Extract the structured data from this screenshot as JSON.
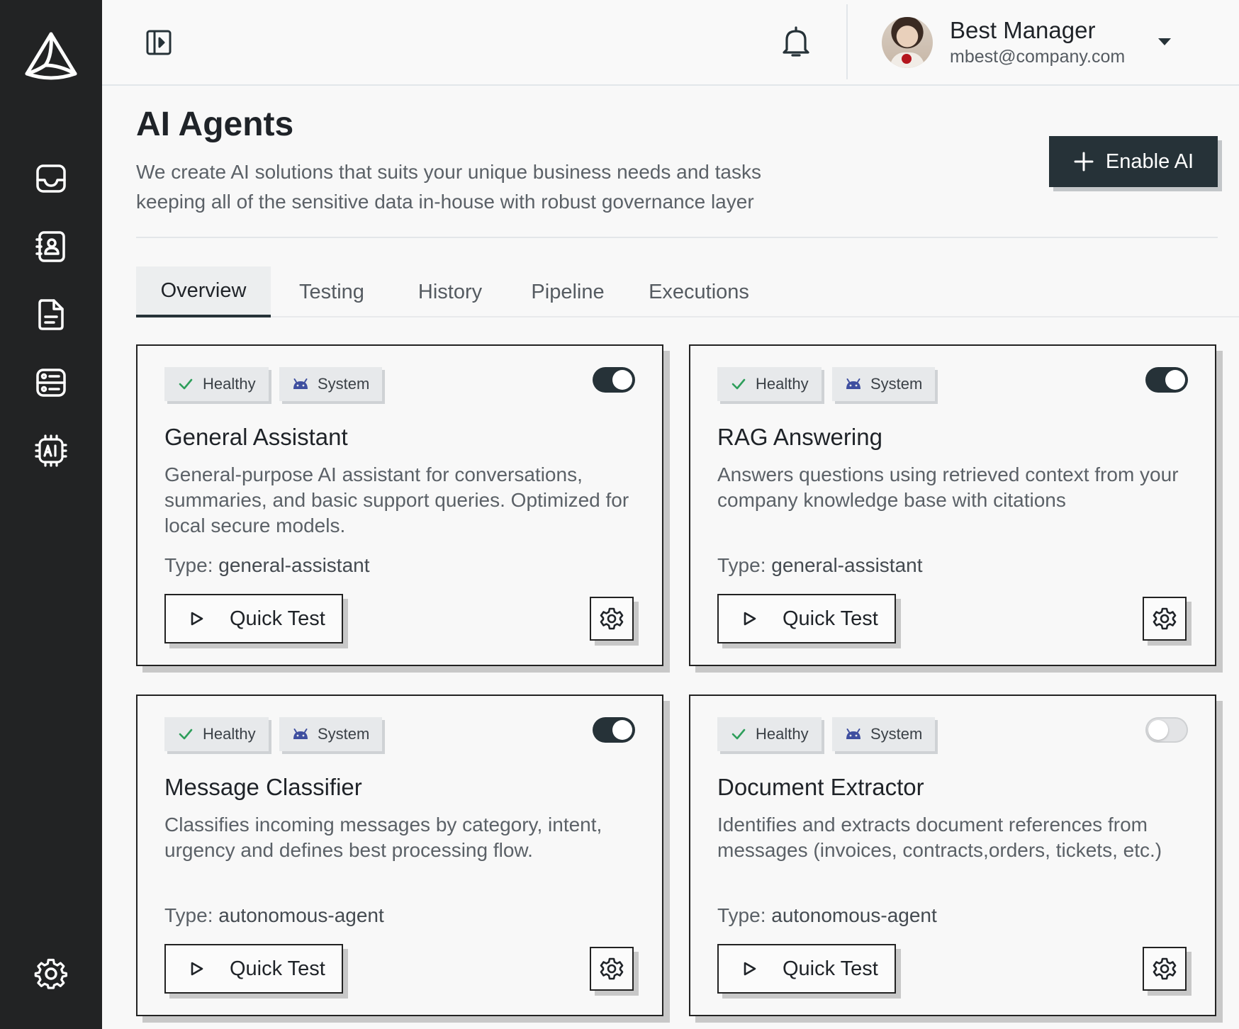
{
  "header": {
    "user_name": "Best Manager",
    "user_email": "mbest@company.com"
  },
  "page": {
    "title": "AI Agents",
    "subtitle": "We create AI solutions that suits your unique business needs and tasks keeping all of the sensitive data in-house with robust governance layer",
    "enable_button": "Enable AI"
  },
  "sidebar": {
    "items": [
      {
        "icon": "inbox-icon"
      },
      {
        "icon": "contacts-icon"
      },
      {
        "icon": "document-icon"
      },
      {
        "icon": "server-icon"
      },
      {
        "icon": "ai-chip-icon"
      }
    ],
    "bottom": {
      "icon": "settings-gear-icon"
    }
  },
  "tabs": [
    {
      "label": "Overview",
      "active": true
    },
    {
      "label": "Testing",
      "active": false
    },
    {
      "label": "History",
      "active": false
    },
    {
      "label": "Pipeline",
      "active": false
    },
    {
      "label": "Executions",
      "active": false
    }
  ],
  "agents": [
    {
      "health": "Healthy",
      "origin": "System",
      "enabled": true,
      "title": "General Assistant",
      "description": "General-purpose AI assistant for conversations, summaries, and basic support queries. Optimized for local secure models.",
      "type_label": "Type:",
      "type": "general-assistant",
      "quick_test": "Quick Test"
    },
    {
      "health": "Healthy",
      "origin": "System",
      "enabled": true,
      "title": "RAG Answering",
      "description": "Answers questions using retrieved context from your company knowledge base with citations",
      "type_label": "Type:",
      "type": "general-assistant",
      "quick_test": "Quick Test"
    },
    {
      "health": "Healthy",
      "origin": "System",
      "enabled": true,
      "title": "Message Classifier",
      "description": "Classifies incoming messages by category, intent, urgency and defines best processing flow.",
      "type_label": "Type:",
      "type": "autonomous-agent",
      "quick_test": "Quick Test"
    },
    {
      "health": "Healthy",
      "origin": "System",
      "enabled": false,
      "title": "Document Extractor",
      "description": "Identifies and extracts document references from messages (invoices, contracts,orders, tickets, etc.)",
      "type_label": "Type:",
      "type": "autonomous-agent",
      "quick_test": "Quick Test"
    }
  ],
  "colors": {
    "sidebar_bg": "#222324",
    "primary": "#263238",
    "healthy_green": "#2e9e5b",
    "system_blue": "#3f4fa0",
    "page_bg": "#f8f8f8"
  }
}
